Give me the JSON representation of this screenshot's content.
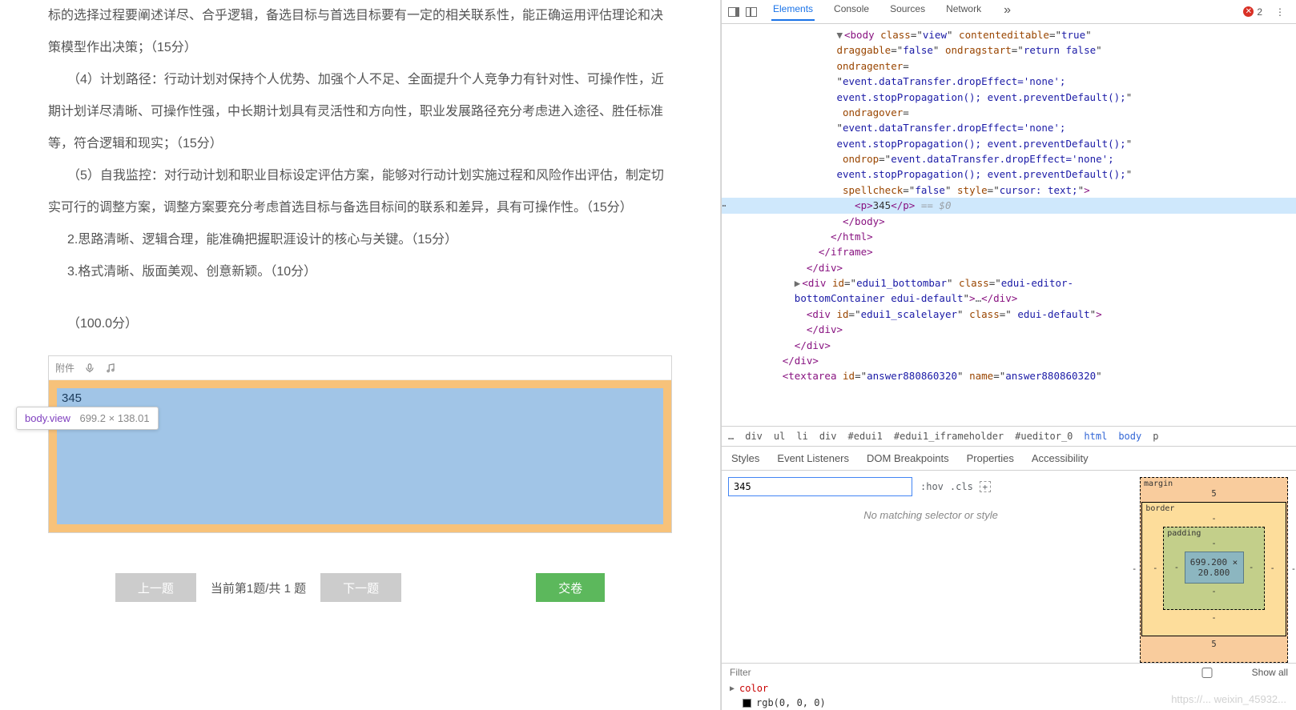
{
  "doc": {
    "p1_tail": "标的选择过程要阐述详尽、合乎逻辑，备选目标与首选目标要有一定的相关联系性，能正确运用评估理论和决策模型作出决策；（15分）",
    "p4": "（4）计划路径：行动计划对保持个人优势、加强个人不足、全面提升个人竞争力有针对性、可操作性，近期计划详尽清晰、可操作性强，中长期计划具有灵活性和方向性，职业发展路径充分考虑进入途径、胜任标准等，符合逻辑和现实；（15分）",
    "p5": "（5）自我监控：对行动计划和职业目标设定评估方案，能够对行动计划实施过程和风险作出评估，制定切实可行的调整方案，调整方案要充分考虑首选目标与备选目标间的联系和差异，具有可操作性。（15分）",
    "p6": "2.思路清晰、逻辑合理，能准确把握职涯设计的核心与关键。（15分）",
    "p7": "3.格式清晰、版面美观、创意新颖。（10分）",
    "score": "（100.0分）"
  },
  "tooltip": {
    "selector": "body.view",
    "dims": "699.2 × 138.01"
  },
  "editor": {
    "toolbar_suffix": "附件",
    "content": "345"
  },
  "nav": {
    "prev": "上一题",
    "status": "当前第1题/共 1 题",
    "next": "下一题",
    "submit": "交卷"
  },
  "devtools": {
    "tabs": [
      "Elements",
      "Console",
      "Sources",
      "Network"
    ],
    "active_tab": "Elements",
    "more": "»",
    "error_count": "2",
    "dom": {
      "l1": "<body class=\"view\" contenteditable=\"true\" draggable=\"false\" ondragstart=\"return false\" ondragenter=\"event.dataTransfer.dropEffect='none'; event.stopPropagation(); event.preventDefault();\" ondragover=\"event.dataTransfer.dropEffect='none'; event.stopPropagation(); event.preventDefault();\" ondrop=\"event.dataTransfer.dropEffect='none'; event.stopPropagation(); event.preventDefault();\" spellcheck=\"false\" style=\"cursor: text;\">",
      "sel_open": "<p>",
      "sel_text": "345",
      "sel_close": "</p>",
      "sel_ghost": " == $0",
      "close_body": "</body>",
      "close_html": "</html>",
      "close_iframe": "</iframe>",
      "close_div": "</div>",
      "bottombar": "<div id=\"edui1_bottombar\" class=\"edui-editor-bottomContainer edui-default\">…</div>",
      "scalelayer": "<div id=\"edui1_scalelayer\" class=\" edui-default\">",
      "textarea": "<textarea id=\"answer880860320\" name=\"answer880860320\""
    },
    "breadcrumb": [
      "…",
      "div",
      "ul",
      "li",
      "div",
      "#edui1",
      "#edui1_iframeholder",
      "#ueditor_0",
      "html",
      "body",
      "p"
    ],
    "styles_tabs": [
      "Styles",
      "Event Listeners",
      "DOM Breakpoints",
      "Properties",
      "Accessibility"
    ],
    "styles": {
      "filter_value": "345",
      "hov": ":hov",
      "cls": ".cls",
      "no_match": "No matching selector or style",
      "filter2_placeholder": "Filter",
      "show_all": "Show all",
      "color_prop": "color",
      "color_val": "rgb(0, 0, 0)"
    },
    "boxmodel": {
      "margin_label": "margin",
      "margin_top": "5",
      "margin_bottom": "5",
      "margin_side": "-",
      "border_label": "border",
      "border_val": "-",
      "padding_label": "padding",
      "padding_val": "-",
      "content": "699.200 × 20.800"
    }
  },
  "watermark": "https://... weixin_45932..."
}
